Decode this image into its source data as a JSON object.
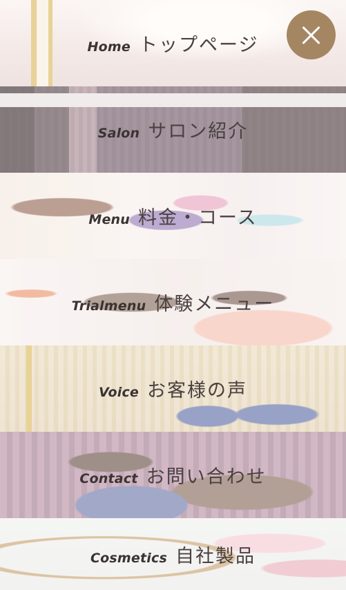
{
  "menu": {
    "items": [
      {
        "en": "Home",
        "jp": "トップページ"
      },
      {
        "en": "Salon",
        "jp": "サロン紹介"
      },
      {
        "en": "Menu",
        "jp": "料金・コース"
      },
      {
        "en": "Trialmenu",
        "jp": "体験メニュー"
      },
      {
        "en": "Voice",
        "jp": "お客様の声"
      },
      {
        "en": "Contact",
        "jp": "お問い合わせ"
      },
      {
        "en": "Cosmetics",
        "jp": "自社製品"
      }
    ],
    "close_icon": "close-icon",
    "close_button_color": "#a58663"
  }
}
